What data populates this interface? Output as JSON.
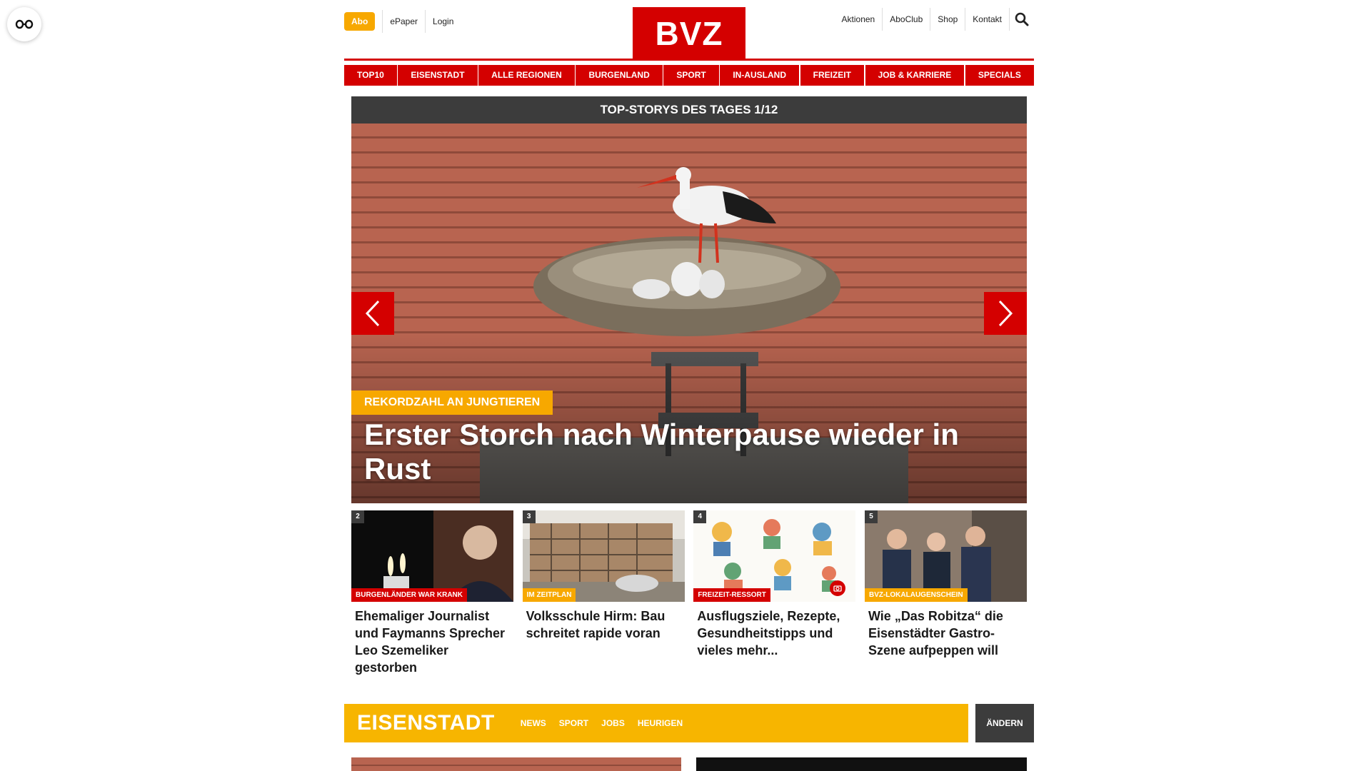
{
  "topbar": {
    "abo": "Abo",
    "left_links": [
      "ePaper",
      "Login"
    ],
    "logo": "BVZ",
    "right_links": [
      "Aktionen",
      "AboClub",
      "Shop",
      "Kontakt"
    ]
  },
  "nav": [
    "TOP10",
    "EISENSTADT",
    "ALLE REGIONEN",
    "BURGENLAND",
    "SPORT",
    "IN-AUSLAND",
    "FREIZEIT",
    "JOB & KARRIERE",
    "SPECIALS"
  ],
  "hero": {
    "header": "TOP-STORYS DES TAGES 1/12",
    "kicker": "REKORDZAHL AN JUNGTIEREN",
    "title": "Erster Storch nach Winterpause wieder in Rust"
  },
  "cards": [
    {
      "num": "2",
      "kicker": "BURGENLÄNDER WAR KRANK",
      "title": "Ehemaliger Journalist und Faymanns Sprecher Leo Szemeliker gestorben"
    },
    {
      "num": "3",
      "kicker": "IM ZEITPLAN",
      "title": "Volksschule Hirm: Bau schreitet rapide voran"
    },
    {
      "num": "4",
      "kicker": "FREIZEIT-RESSORT",
      "title": "Ausflugsziele, Rezepte, Gesundheitstipps und vieles mehr..."
    },
    {
      "num": "5",
      "kicker": "BVZ-LOKALAUGENSCHEIN",
      "title": "Wie „Das Robitza“ die Eisenstädter Gastro-Szene aufpeppen will"
    }
  ],
  "region": {
    "title": "EISENSTADT",
    "links": [
      "NEWS",
      "SPORT",
      "JOBS",
      "HEURIGEN"
    ],
    "change": "ÄNDERN"
  },
  "colors": {
    "brand_red": "#d40000",
    "accent_yellow": "#f7a800",
    "dark_bar": "#3c3c3c"
  }
}
